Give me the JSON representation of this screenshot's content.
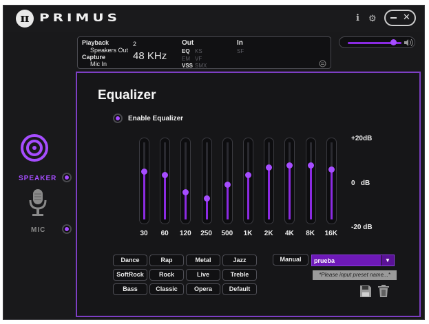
{
  "app": {
    "brand": "PRIMUS",
    "logo_glyph": "π",
    "info_glyph": "i",
    "settings_glyph": "⚙",
    "close_glyph": "✕"
  },
  "info_panel": {
    "playback_label": "Playback",
    "playback_device": "Speakers Out",
    "capture_label": "Capture",
    "capture_device": "Mic In",
    "channels": "2",
    "sample_rate": "48 KHz",
    "out_label": "Out",
    "out_items": [
      "EQ",
      "KS",
      "EM",
      "VF",
      "VSS",
      "SMX"
    ],
    "in_label": "In",
    "in_items": [
      "SF"
    ]
  },
  "volume": {
    "level": 0.85
  },
  "sidebar": {
    "speaker_label": "SPEAKER",
    "mic_label": "MIC"
  },
  "equalizer": {
    "title": "Equalizer",
    "enable_label": "Enable Equalizer",
    "db_labels": [
      "+20dB",
      "0   dB",
      "-20 dB"
    ],
    "bands": [
      {
        "freq": "30",
        "db": 5
      },
      {
        "freq": "60",
        "db": 3
      },
      {
        "freq": "120",
        "db": -6
      },
      {
        "freq": "250",
        "db": -9
      },
      {
        "freq": "500",
        "db": -2
      },
      {
        "freq": "1K",
        "db": 3
      },
      {
        "freq": "2K",
        "db": 7
      },
      {
        "freq": "4K",
        "db": 8
      },
      {
        "freq": "8K",
        "db": 8
      },
      {
        "freq": "16K",
        "db": 6
      }
    ]
  },
  "presets": [
    [
      "Dance",
      "Rap",
      "Metal",
      "Jazz"
    ],
    [
      "SoftRock",
      "Rock",
      "Live",
      "Treble"
    ],
    [
      "Bass",
      "Classic",
      "Opera",
      "Default"
    ]
  ],
  "manual_label": "Manual",
  "preset_name": {
    "value": "prueba",
    "tooltip": "*Please input preset name...*"
  },
  "colors": {
    "accent": "#a64dff",
    "border": "#7d3fc4"
  }
}
